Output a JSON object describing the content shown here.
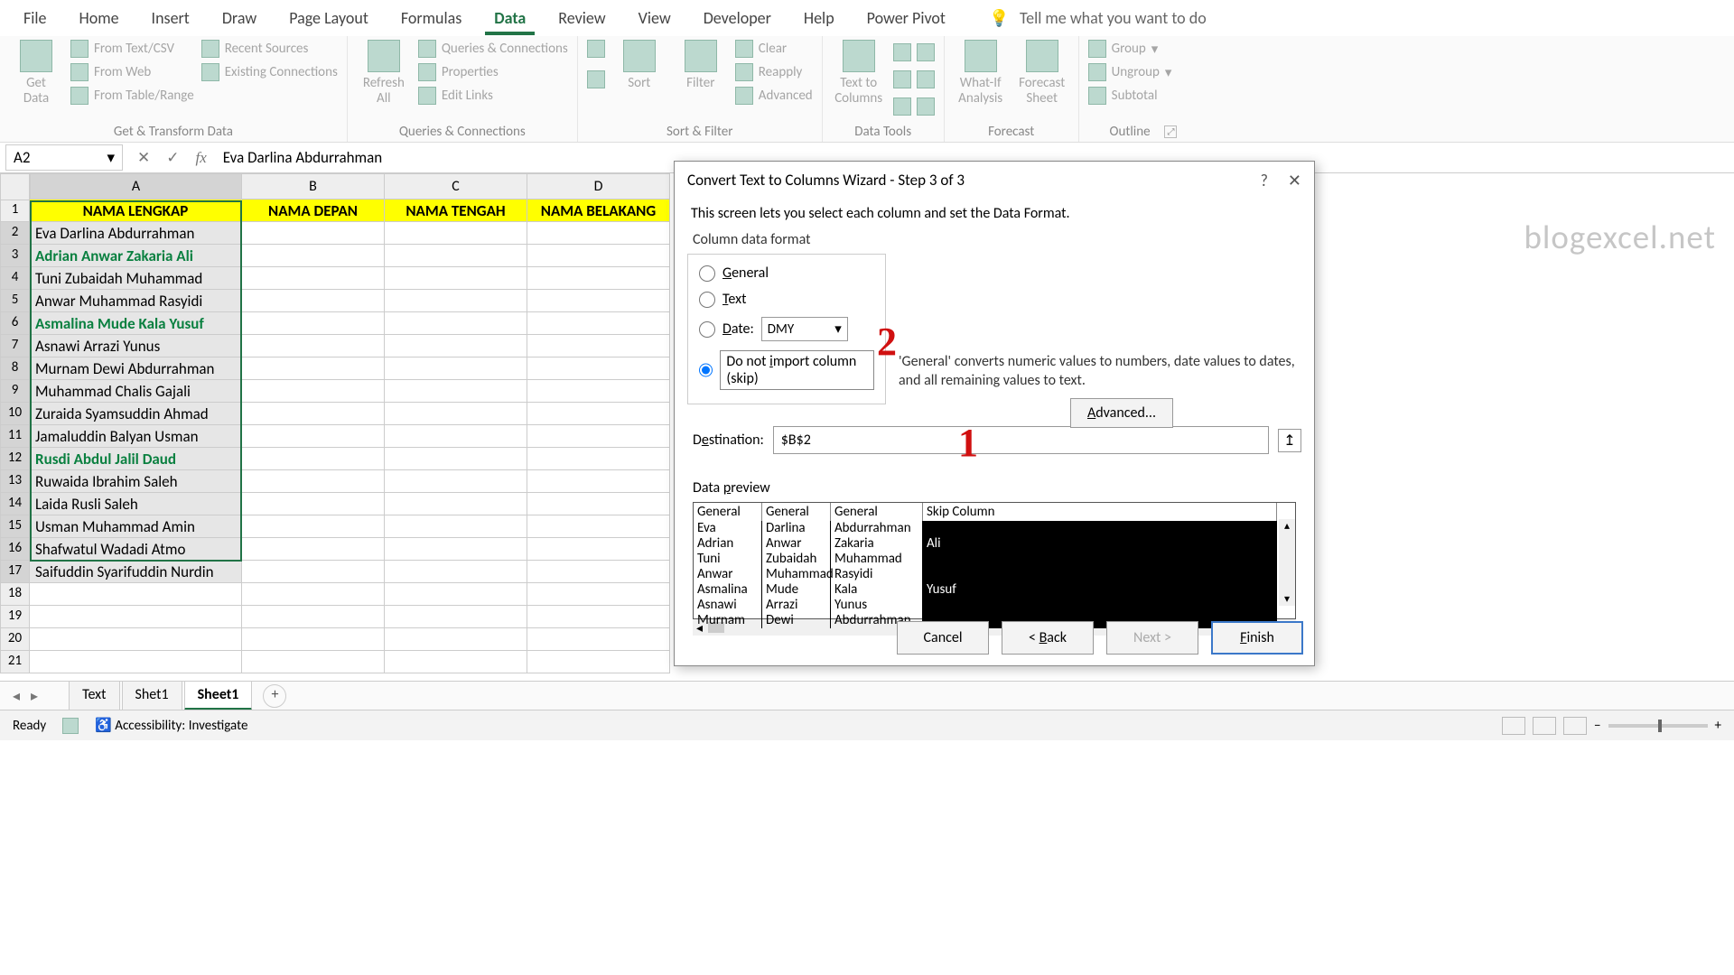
{
  "ribbon_tabs": [
    "File",
    "Home",
    "Insert",
    "Draw",
    "Page Layout",
    "Formulas",
    "Data",
    "Review",
    "View",
    "Developer",
    "Help",
    "Power Pivot"
  ],
  "active_tab": "Data",
  "tell_me": "Tell me what you want to do",
  "groups": {
    "get_transform": {
      "label": "Get & Transform Data",
      "get_data": "Get\nData",
      "items": [
        "From Text/CSV",
        "From Web",
        "From Table/Range",
        "Recent Sources",
        "Existing Connections"
      ]
    },
    "queries": {
      "label": "Queries & Connections",
      "refresh": "Refresh\nAll",
      "items": [
        "Queries & Connections",
        "Properties",
        "Edit Links"
      ]
    },
    "sort_filter": {
      "label": "Sort & Filter",
      "sort": "Sort",
      "filter": "Filter",
      "items": [
        "Clear",
        "Reapply",
        "Advanced"
      ]
    },
    "data_tools": {
      "label": "Data Tools",
      "text_to_cols": "Text to\nColumns"
    },
    "forecast": {
      "label": "Forecast",
      "whatif": "What-If\nAnalysis",
      "sheet": "Forecast\nSheet"
    },
    "outline": {
      "label": "Outline",
      "items": [
        "Group",
        "Ungroup",
        "Subtotal"
      ]
    }
  },
  "namebox": "A2",
  "formula_value": "Eva Darlina Abdurrahman",
  "columns": [
    "A",
    "B",
    "C",
    "D"
  ],
  "header_row": [
    "NAMA LENGKAP",
    "NAMA DEPAN",
    "NAMA TENGAH",
    "NAMA BELAKANG"
  ],
  "data_rows": [
    {
      "n": 2,
      "t": "Eva Darlina Abdurrahman",
      "g": false
    },
    {
      "n": 3,
      "t": "Adrian Anwar Zakaria Ali",
      "g": true
    },
    {
      "n": 4,
      "t": "Tuni Zubaidah Muhammad",
      "g": false
    },
    {
      "n": 5,
      "t": "Anwar Muhammad Rasyidi",
      "g": false
    },
    {
      "n": 6,
      "t": "Asmalina Mude Kala Yusuf",
      "g": true
    },
    {
      "n": 7,
      "t": "Asnawi Arrazi Yunus",
      "g": false
    },
    {
      "n": 8,
      "t": "Murnam Dewi Abdurrahman",
      "g": false
    },
    {
      "n": 9,
      "t": "Muhammad Chalis Gajali",
      "g": false
    },
    {
      "n": 10,
      "t": "Zuraida Syamsuddin Ahmad",
      "g": false
    },
    {
      "n": 11,
      "t": "Jamaluddin Balyan Usman",
      "g": false
    },
    {
      "n": 12,
      "t": "Rusdi Abdul Jalil Daud",
      "g": true
    },
    {
      "n": 13,
      "t": "Ruwaida Ibrahim Saleh",
      "g": false
    },
    {
      "n": 14,
      "t": "Laida Rusli Saleh",
      "g": false
    },
    {
      "n": 15,
      "t": "Usman Muhammad Amin",
      "g": false
    },
    {
      "n": 16,
      "t": "Shafwatul Wadadi Atmo",
      "g": false
    },
    {
      "n": 17,
      "t": "Saifuddin Syarifuddin Nurdin",
      "g": false
    }
  ],
  "empty_rows": [
    18,
    19,
    20,
    21
  ],
  "dialog": {
    "title": "Convert Text to Columns Wizard - Step 3 of 3",
    "desc": "This screen lets you select each column and set the Data Format.",
    "section": "Column data format",
    "radios": {
      "general": "General",
      "text": "Text",
      "date": "Date:",
      "skip": "Do not import column (skip)"
    },
    "date_format": "DMY",
    "general_hint": "'General' converts numeric values to numbers, date values to dates, and all remaining values to text.",
    "advanced": "Advanced...",
    "destination_label": "Destination:",
    "destination": "$B$2",
    "preview_label": "Data preview",
    "preview_headers": [
      "General",
      "General",
      "General",
      "Skip Column"
    ],
    "preview_rows": [
      [
        "Eva",
        "Darlina",
        "Abdurrahman",
        ""
      ],
      [
        "Adrian",
        "Anwar",
        "Zakaria",
        "Ali"
      ],
      [
        "Tuni",
        "Zubaidah",
        "Muhammad",
        ""
      ],
      [
        "Anwar",
        "Muhammad",
        "Rasyidi",
        ""
      ],
      [
        "Asmalina",
        "Mude",
        "Kala",
        "Yusuf"
      ],
      [
        "Asnawi",
        "Arrazi",
        "Yunus",
        ""
      ],
      [
        "Murnam",
        "Dewi",
        "Abdurrahman",
        ""
      ]
    ],
    "buttons": {
      "cancel": "Cancel",
      "back": "< Back",
      "next": "Next >",
      "finish": "Finish"
    }
  },
  "annotations": {
    "one": "1",
    "two": "2"
  },
  "watermark": "blogexcel.net",
  "sheet_tabs": [
    "Text",
    "Shet1",
    "Sheet1"
  ],
  "active_sheet": "Sheet1",
  "status": {
    "ready": "Ready",
    "accessibility": "Accessibility: Investigate",
    "zoom": "100%"
  }
}
